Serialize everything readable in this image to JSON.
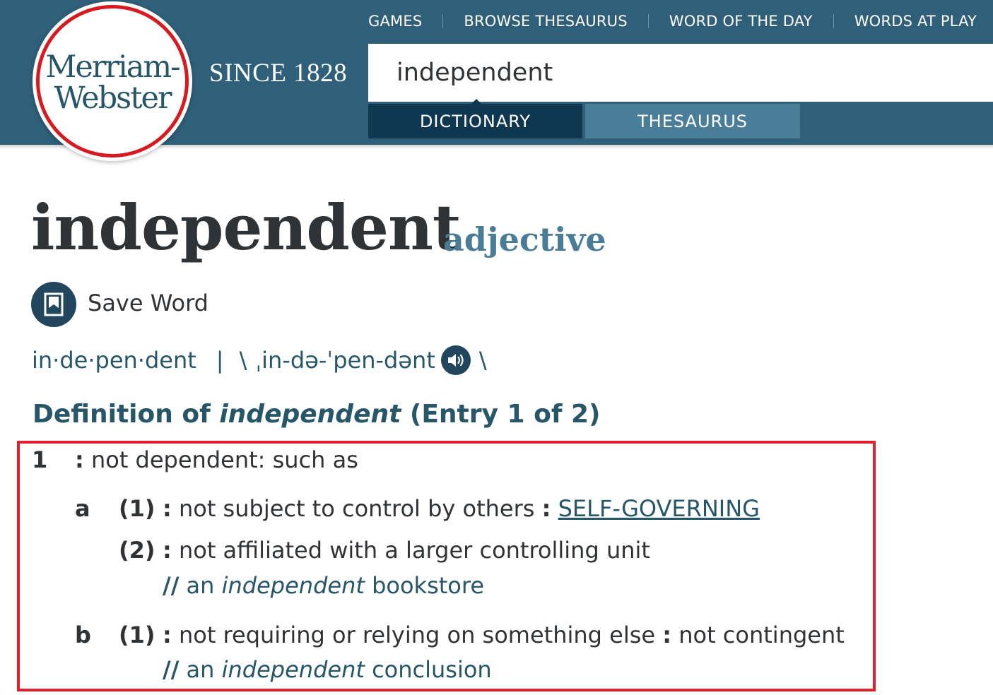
{
  "brand": {
    "logo_line1": "Merriam-",
    "logo_line2": "Webster",
    "since": "SINCE 1828",
    "colors": {
      "header_bg": "#305f7a",
      "accent_red": "#d71920",
      "dark_tab": "#0f3850",
      "light_tab": "#4a7d98"
    }
  },
  "topnav": {
    "items": [
      "GAMES",
      "BROWSE THESAURUS",
      "WORD OF THE DAY",
      "WORDS AT PLAY"
    ]
  },
  "search": {
    "value": "independent",
    "tabs": [
      "DICTIONARY",
      "THESAURUS"
    ],
    "active_tab": "DICTIONARY"
  },
  "entry": {
    "headword": "independent",
    "part_of_speech": "adjective",
    "save_label": "Save Word",
    "syllables": "in·de·pen·dent",
    "separator": "|",
    "pron_open": "\\",
    "pronunciation": "ˌin-də-ˈpen-dənt",
    "pron_close": "\\",
    "def_heading": {
      "prefix": "Definition of ",
      "word": "independent",
      "suffix": " (Entry 1 of 2)"
    }
  },
  "definitions": {
    "sense1": {
      "num": "1",
      "colon": ":",
      "text": " not dependent: such as"
    },
    "sense1a1": {
      "letter": "a",
      "num": "(1)",
      "colon": ":",
      "text": " not subject to control by others ",
      "colon2": ":",
      "link": "SELF-GOVERNING"
    },
    "sense1a2": {
      "num": "(2)",
      "colon": ":",
      "text": " not affiliated with a larger controlling unit",
      "example": {
        "marks": "//",
        "pre": " an ",
        "word": "independent",
        "post": " bookstore"
      }
    },
    "sense1b1": {
      "letter": "b",
      "num": "(1)",
      "colon": ":",
      "text": " not requiring or relying on something else ",
      "colon2": ":",
      "text2": " not contingent",
      "example": {
        "marks": "//",
        "pre": " an ",
        "word": "independent",
        "post": " conclusion"
      }
    }
  }
}
